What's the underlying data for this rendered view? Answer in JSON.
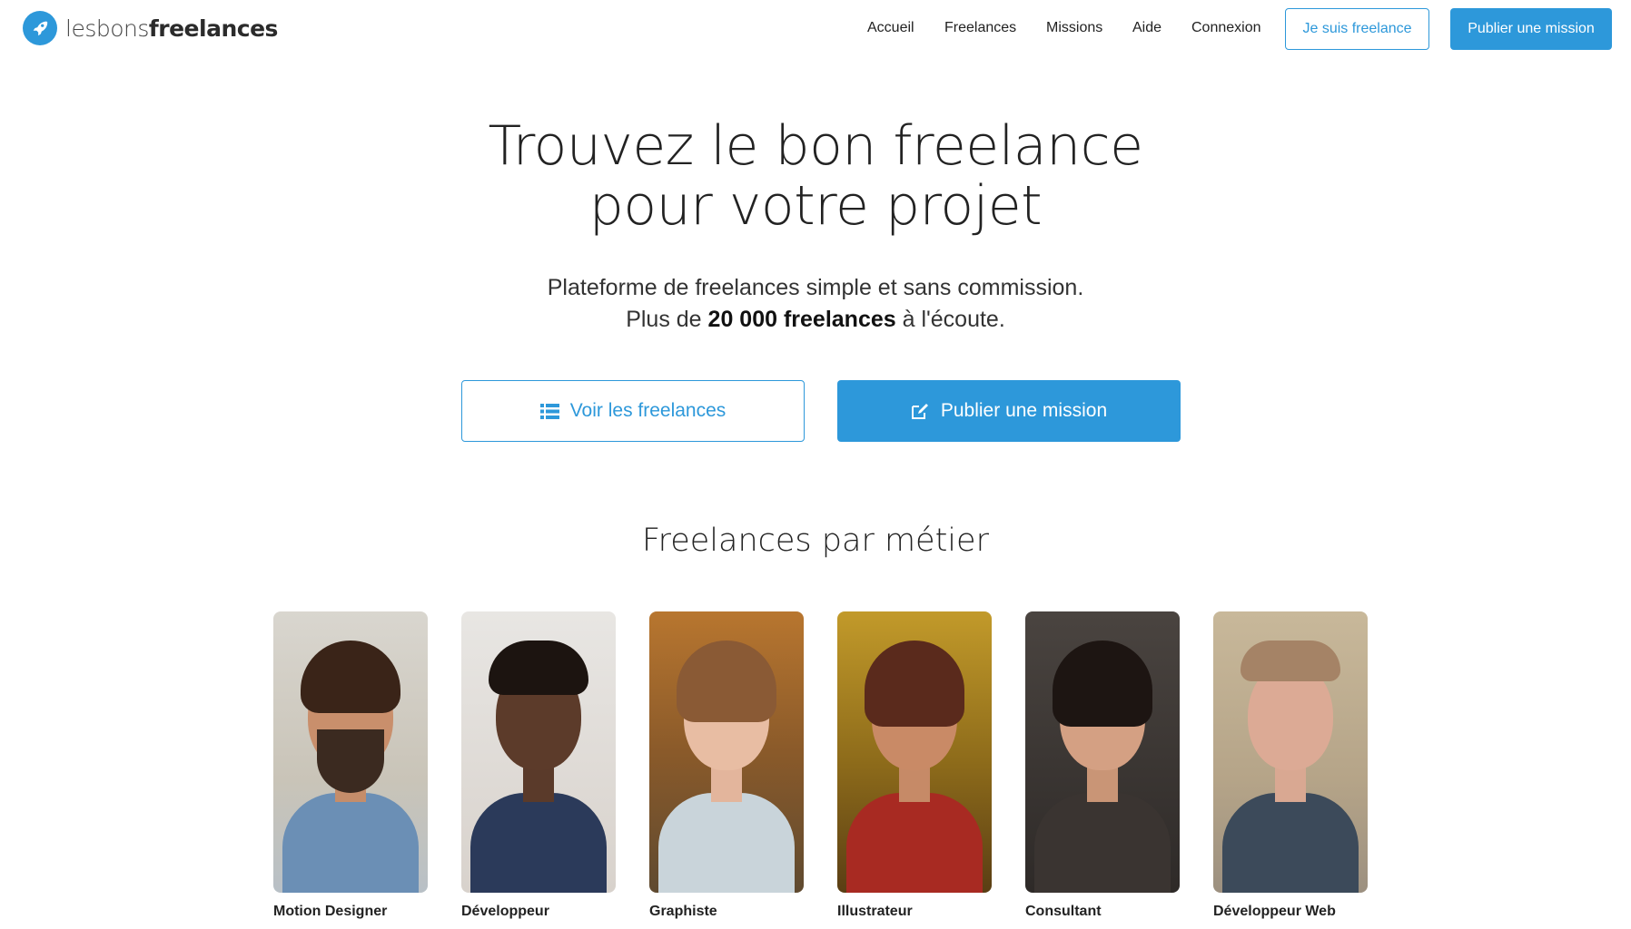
{
  "brand": {
    "light": "lesbons",
    "bold": "freelances",
    "accent": "#2d98da"
  },
  "nav": {
    "links": [
      "Accueil",
      "Freelances",
      "Missions",
      "Aide",
      "Connexion"
    ],
    "freelance_button": "Je suis freelance",
    "publish_button": "Publier une mission"
  },
  "hero": {
    "title_line1": "Trouvez le bon freelance",
    "title_line2": "pour votre projet",
    "subtitle_line1": "Plateforme de freelances simple et sans commission.",
    "subtitle_line2_pre": "Plus de ",
    "subtitle_line2_bold": "20 000 freelances",
    "subtitle_line2_post": " à l'écoute.",
    "cta_list": "Voir les freelances",
    "cta_list_icon": "list-icon",
    "cta_publish": "Publier une mission",
    "cta_publish_icon": "edit-icon"
  },
  "section": {
    "title": "Freelances par métier"
  },
  "professions": [
    {
      "label": "Motion Designer"
    },
    {
      "label": "Développeur"
    },
    {
      "label": "Graphiste"
    },
    {
      "label": "Illustrateur"
    },
    {
      "label": "Consultant"
    },
    {
      "label": "Développeur Web"
    }
  ]
}
